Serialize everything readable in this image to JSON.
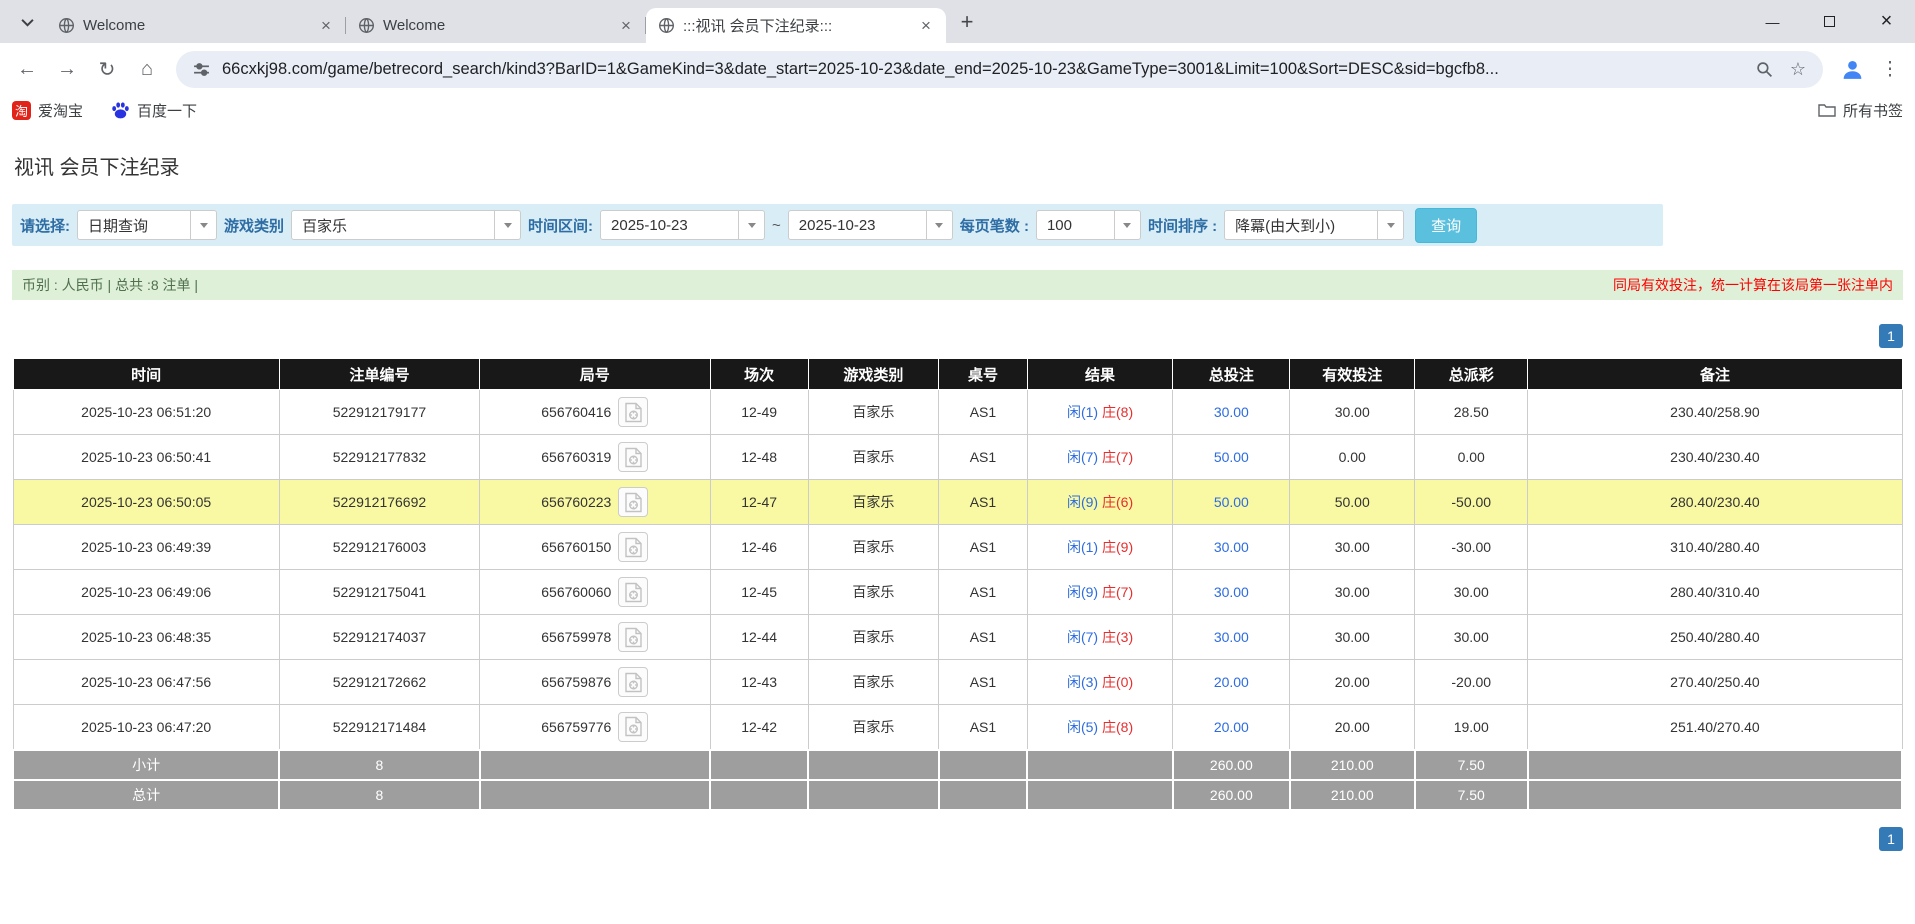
{
  "colors": {
    "accent_blue": "#2d6ce0",
    "banker_red": "#e62e2e",
    "negative_red": "#ff0000",
    "highlight_yellow": "#f9f9a3",
    "filter_bg": "#d9edf7",
    "info_bg": "#dff0d8",
    "header_bg": "#181818",
    "footer_bg": "#9e9e9e",
    "button_blue": "#5bc0de",
    "pager_blue": "#337ab7"
  },
  "icons": {
    "back": "←",
    "forward": "→",
    "refresh": "↻",
    "home": "⌂",
    "star": "☆",
    "menu_dots": "⋮",
    "new_tab": "+",
    "close_tab": "×",
    "minimize": "—",
    "close_window": "×",
    "taobao_glyph": "淘"
  },
  "browser": {
    "tabs": [
      {
        "title": "Welcome"
      },
      {
        "title": "Welcome"
      },
      {
        "title": ":::视讯 会员下注纪录:::"
      }
    ],
    "url": "66cxkj98.com/game/betrecord_search/kind3?BarID=1&GameKind=3&date_start=2025-10-23&date_end=2025-10-23&GameType=3001&Limit=100&Sort=DESC&sid=bgcfb8...",
    "bookmarks": [
      {
        "label": "爱淘宝"
      },
      {
        "label": "百度一下"
      }
    ],
    "all_bookmarks_label": "所有书签"
  },
  "page": {
    "title": "视讯 会员下注纪录",
    "filters": {
      "select_label": "请选择:",
      "select_value": "日期查询",
      "game_type_label": "游戏类别",
      "game_type_value": "百家乐",
      "date_range_label": "时间区间:",
      "date_start": "2025-10-23",
      "date_separator": "~",
      "date_end": "2025-10-23",
      "page_size_label": "每页笔数 :",
      "page_size_value": "100",
      "sort_label": "时间排序 :",
      "sort_value": "降冪(由大到小)",
      "search_button": "查询"
    },
    "info_bar": {
      "left": "币别 : 人民币 | 总共 :8 注单 |",
      "right": "同局有效投注，统一计算在该局第一张注单内"
    },
    "pagination": "1",
    "table": {
      "headers": [
        "时间",
        "注单编号",
        "局号",
        "场次",
        "游戏类别",
        "桌号",
        "结果",
        "总投注",
        "有效投注",
        "总派彩",
        "备注"
      ],
      "rows": [
        {
          "time": "2025-10-23 06:51:20",
          "bet_id": "522912179177",
          "round": "656760416",
          "session": "12-49",
          "game": "百家乐",
          "table_no": "AS1",
          "result_player": "闲(1)",
          "result_banker": "庄(8)",
          "total_bet": "30.00",
          "valid_bet": "30.00",
          "payout": "28.50",
          "payout_negative": false,
          "remark": "230.40/258.90",
          "highlight": false
        },
        {
          "time": "2025-10-23 06:50:41",
          "bet_id": "522912177832",
          "round": "656760319",
          "session": "12-48",
          "game": "百家乐",
          "table_no": "AS1",
          "result_player": "闲(7)",
          "result_banker": "庄(7)",
          "total_bet": "50.00",
          "valid_bet": "0.00",
          "payout": "0.00",
          "payout_negative": false,
          "remark": "230.40/230.40",
          "highlight": false
        },
        {
          "time": "2025-10-23 06:50:05",
          "bet_id": "522912176692",
          "round": "656760223",
          "session": "12-47",
          "game": "百家乐",
          "table_no": "AS1",
          "result_player": "闲(9)",
          "result_banker": "庄(6)",
          "total_bet": "50.00",
          "valid_bet": "50.00",
          "payout": "-50.00",
          "payout_negative": true,
          "remark": "280.40/230.40",
          "highlight": true
        },
        {
          "time": "2025-10-23 06:49:39",
          "bet_id": "522912176003",
          "round": "656760150",
          "session": "12-46",
          "game": "百家乐",
          "table_no": "AS1",
          "result_player": "闲(1)",
          "result_banker": "庄(9)",
          "total_bet": "30.00",
          "valid_bet": "30.00",
          "payout": "-30.00",
          "payout_negative": true,
          "remark": "310.40/280.40",
          "highlight": false
        },
        {
          "time": "2025-10-23 06:49:06",
          "bet_id": "522912175041",
          "round": "656760060",
          "session": "12-45",
          "game": "百家乐",
          "table_no": "AS1",
          "result_player": "闲(9)",
          "result_banker": "庄(7)",
          "total_bet": "30.00",
          "valid_bet": "30.00",
          "payout": "30.00",
          "payout_negative": false,
          "remark": "280.40/310.40",
          "highlight": false
        },
        {
          "time": "2025-10-23 06:48:35",
          "bet_id": "522912174037",
          "round": "656759978",
          "session": "12-44",
          "game": "百家乐",
          "table_no": "AS1",
          "result_player": "闲(7)",
          "result_banker": "庄(3)",
          "total_bet": "30.00",
          "valid_bet": "30.00",
          "payout": "30.00",
          "payout_negative": false,
          "remark": "250.40/280.40",
          "highlight": false
        },
        {
          "time": "2025-10-23 06:47:56",
          "bet_id": "522912172662",
          "round": "656759876",
          "session": "12-43",
          "game": "百家乐",
          "table_no": "AS1",
          "result_player": "闲(3)",
          "result_banker": "庄(0)",
          "total_bet": "20.00",
          "valid_bet": "20.00",
          "payout": "-20.00",
          "payout_negative": true,
          "remark": "270.40/250.40",
          "highlight": false
        },
        {
          "time": "2025-10-23 06:47:20",
          "bet_id": "522912171484",
          "round": "656759776",
          "session": "12-42",
          "game": "百家乐",
          "table_no": "AS1",
          "result_player": "闲(5)",
          "result_banker": "庄(8)",
          "total_bet": "20.00",
          "valid_bet": "20.00",
          "payout": "19.00",
          "payout_negative": false,
          "remark": "251.40/270.40",
          "highlight": false
        }
      ],
      "subtotal": {
        "label": "小计",
        "count": "8",
        "total_bet": "260.00",
        "valid_bet": "210.00",
        "payout": "7.50"
      },
      "total": {
        "label": "总计",
        "count": "8",
        "total_bet": "260.00",
        "valid_bet": "210.00",
        "payout": "7.50"
      }
    }
  }
}
